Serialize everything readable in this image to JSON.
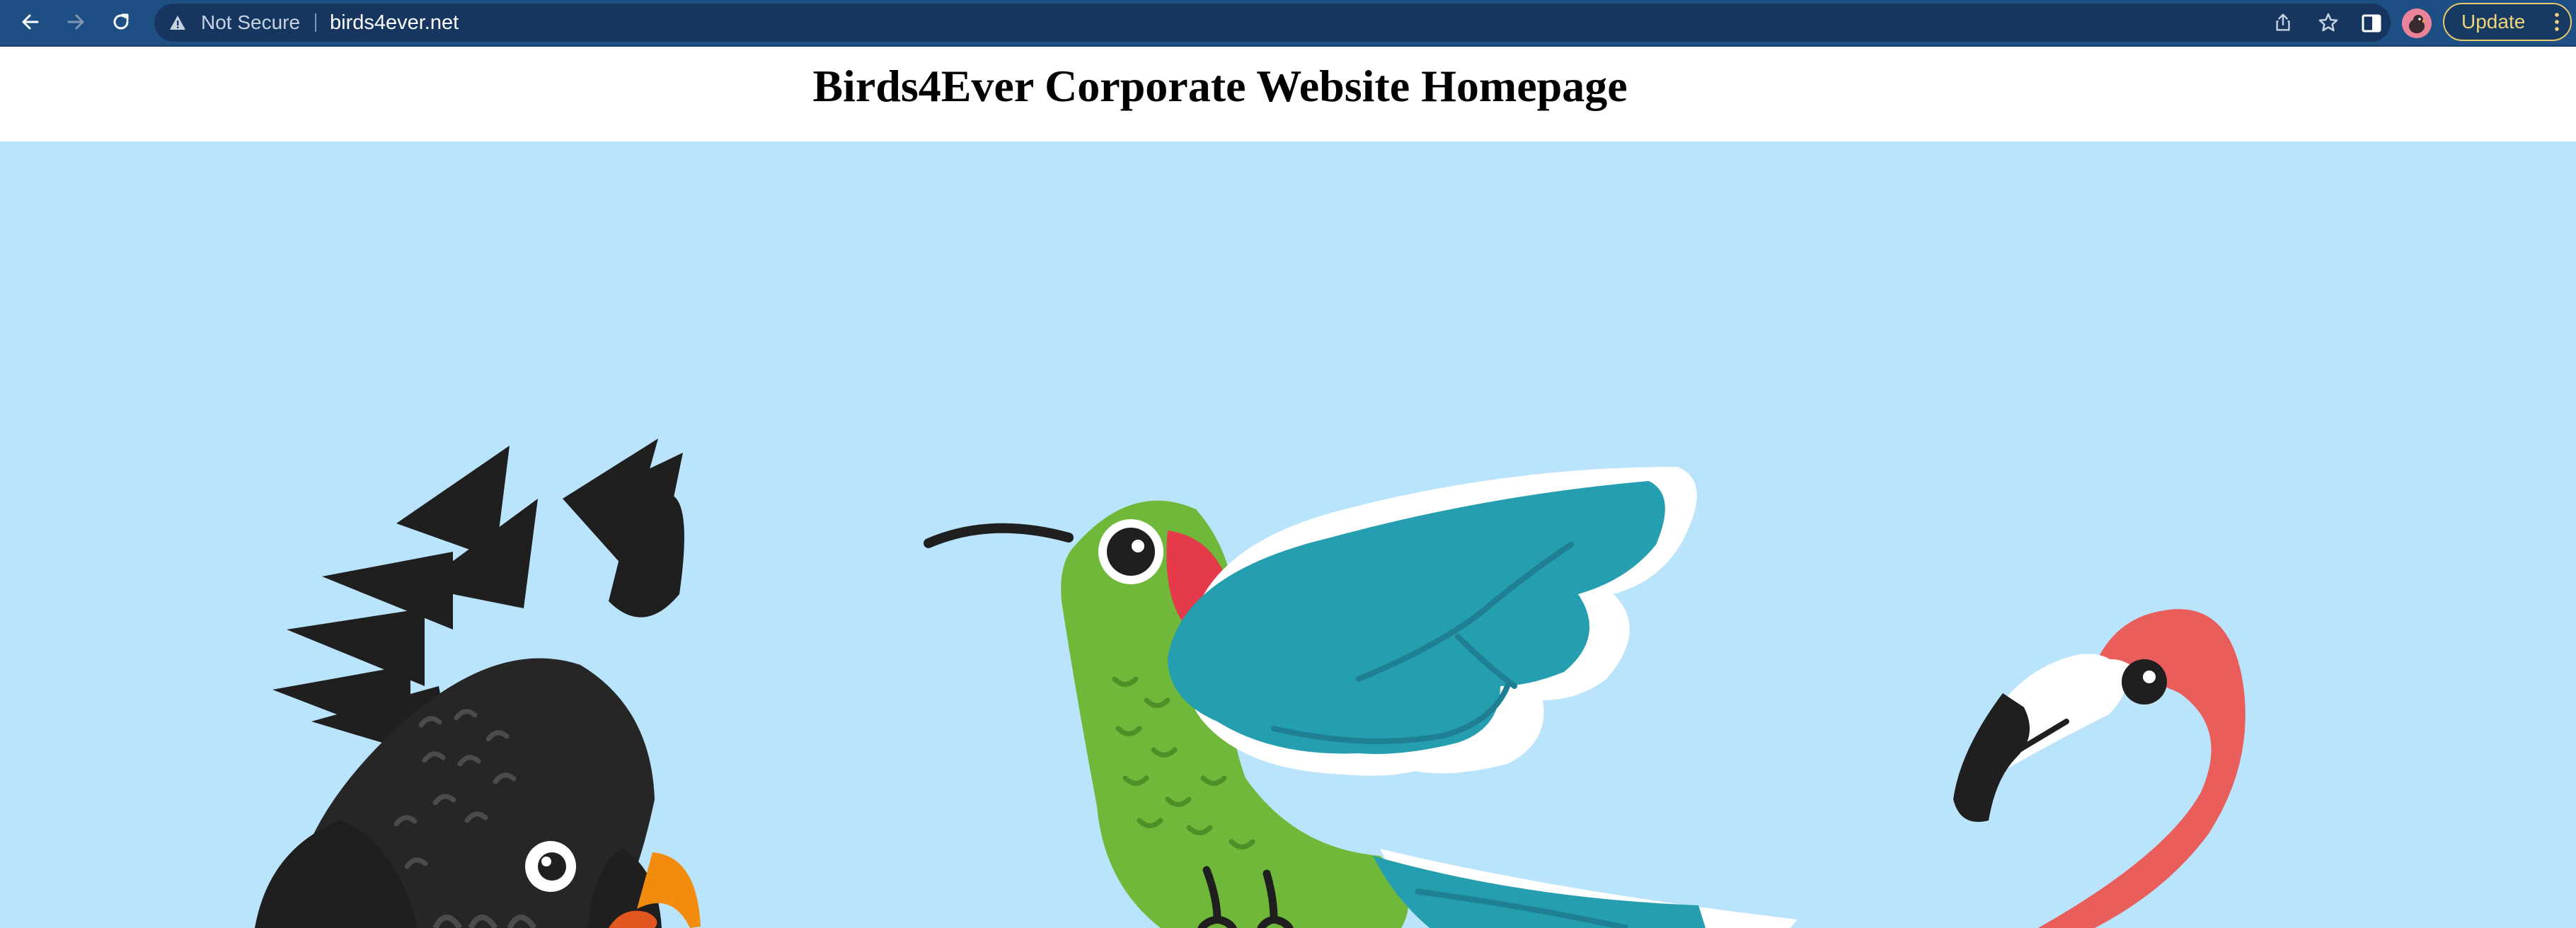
{
  "browser": {
    "security_label": "Not Secure",
    "url": "birds4ever.net",
    "update_label": "Update",
    "icons": {
      "back": "back-arrow-icon",
      "forward": "forward-arrow-icon",
      "reload": "reload-icon",
      "security": "warning-icon",
      "share": "share-icon",
      "bookmark": "star-icon",
      "side_panel": "side-panel-icon",
      "profile": "profile-avatar",
      "menu": "more-vert-icon"
    },
    "colors": {
      "toolbar": "#1e4f84",
      "omnibox": "#16365f",
      "update_accent": "#f2d37a"
    }
  },
  "page": {
    "title": "Birds4Ever Corporate Website Homepage",
    "hero": {
      "background": "#b9e4fb",
      "birds": [
        "black cockatoo",
        "hummingbird",
        "flamingo"
      ]
    }
  }
}
